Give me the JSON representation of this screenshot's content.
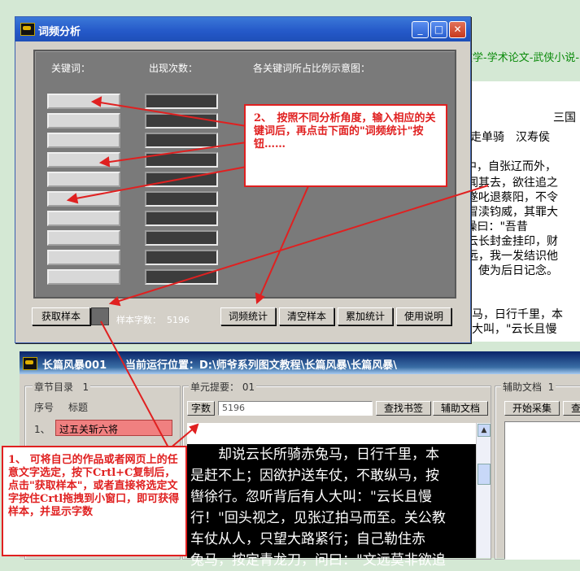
{
  "background": {
    "link_text": "文学-学术论文-武侠小说-",
    "lines": [
      "三国",
      "千里走单骑　汉寿侯",
      "中，自张辽而外，",
      "闻其去，欲往追之",
      "遂叱退蔡阳，不令",
      "冒渎钧威，其罪大",
      "\"操曰：\"吾昔",
      "云长封金挂印，财",
      "远，我一发结识他",
      "，使为后日记念。",
      "马，日行千里，本",
      "大叫，\"云长且慢",
      "\"大路紧行；自己勒住"
    ]
  },
  "window1": {
    "title": "词频分析",
    "col_keyword": "关键词：",
    "col_count": "出现次数：",
    "col_ratio": "各关键词所占比例示意图：",
    "keyword_inputs": [
      "",
      "",
      "",
      "",
      "",
      "",
      "",
      "",
      "",
      ""
    ],
    "count_values": [
      "",
      "",
      "",
      "",
      "",
      "",
      "",
      "",
      "",
      ""
    ],
    "btn_get_sample": "获取样本",
    "sample_chars_label": "样本字数：",
    "sample_chars_value": "5196",
    "btn_stats": "词频统计",
    "btn_clear": "清空样本",
    "btn_accumulate": "累加统计",
    "btn_help": "使用说明"
  },
  "callout2": {
    "text": "2、　按照不同分析角度，输入相应的关键词后，再点击下面的\"词频统计\"按钮……"
  },
  "callout1": {
    "text": "1、 可将自己的作品或者网页上的任意文字选定，按下Crtl+C复制后，点击\"获取样本\"，或者直接将选定文字按住Crtl拖拽到小窗口，即可获得样本，并显示字数"
  },
  "window2": {
    "app_name": "长篇风暴001",
    "run_location": "当前运行位置：D:\\师爷系列图文教程\\长篇风暴\\长篇风暴\\",
    "chapter_dir_label": "章节目录",
    "chapter_dir_count": "1",
    "col_index": "序号",
    "col_title": "标题",
    "chapter_row_index": "1、",
    "chapter_row_title": "过五关斩六将",
    "unit_summary_label": "单元提要：",
    "unit_summary_value": "01",
    "word_count_label": "字数",
    "word_count_value": "5196",
    "btn_find_bookmark": "查找书签",
    "btn_aux_doc": "辅助文档",
    "aux_doc_label": "辅助文档",
    "aux_doc_count": "1",
    "btn_start_collect": "开始采集",
    "btn_find_short": "查",
    "reader_lines": [
      "　　却说云长所骑赤兔马，日行千里，本",
      "是赶不上；因欲护送车仗，不敢纵马，按",
      "辔徐行。忽听背后有人大叫：\"云长且慢",
      "行！\"回头视之，见张辽拍马而至。关公教",
      "车仗从人，只望大路紧行；自己勒住赤",
      "兔马，按定青龙刀，问曰：\"文远莫非欲追"
    ]
  },
  "colors": {
    "title_blue": "#2458c8",
    "callout_red": "#e02020",
    "panel_gray": "#7a7a7a",
    "reader_bg": "#000000",
    "chapter_selected": "#f08080"
  },
  "icons": [
    "app-logo-icon",
    "minimize-icon",
    "maximize-icon",
    "close-icon",
    "scroll-up-icon"
  ]
}
